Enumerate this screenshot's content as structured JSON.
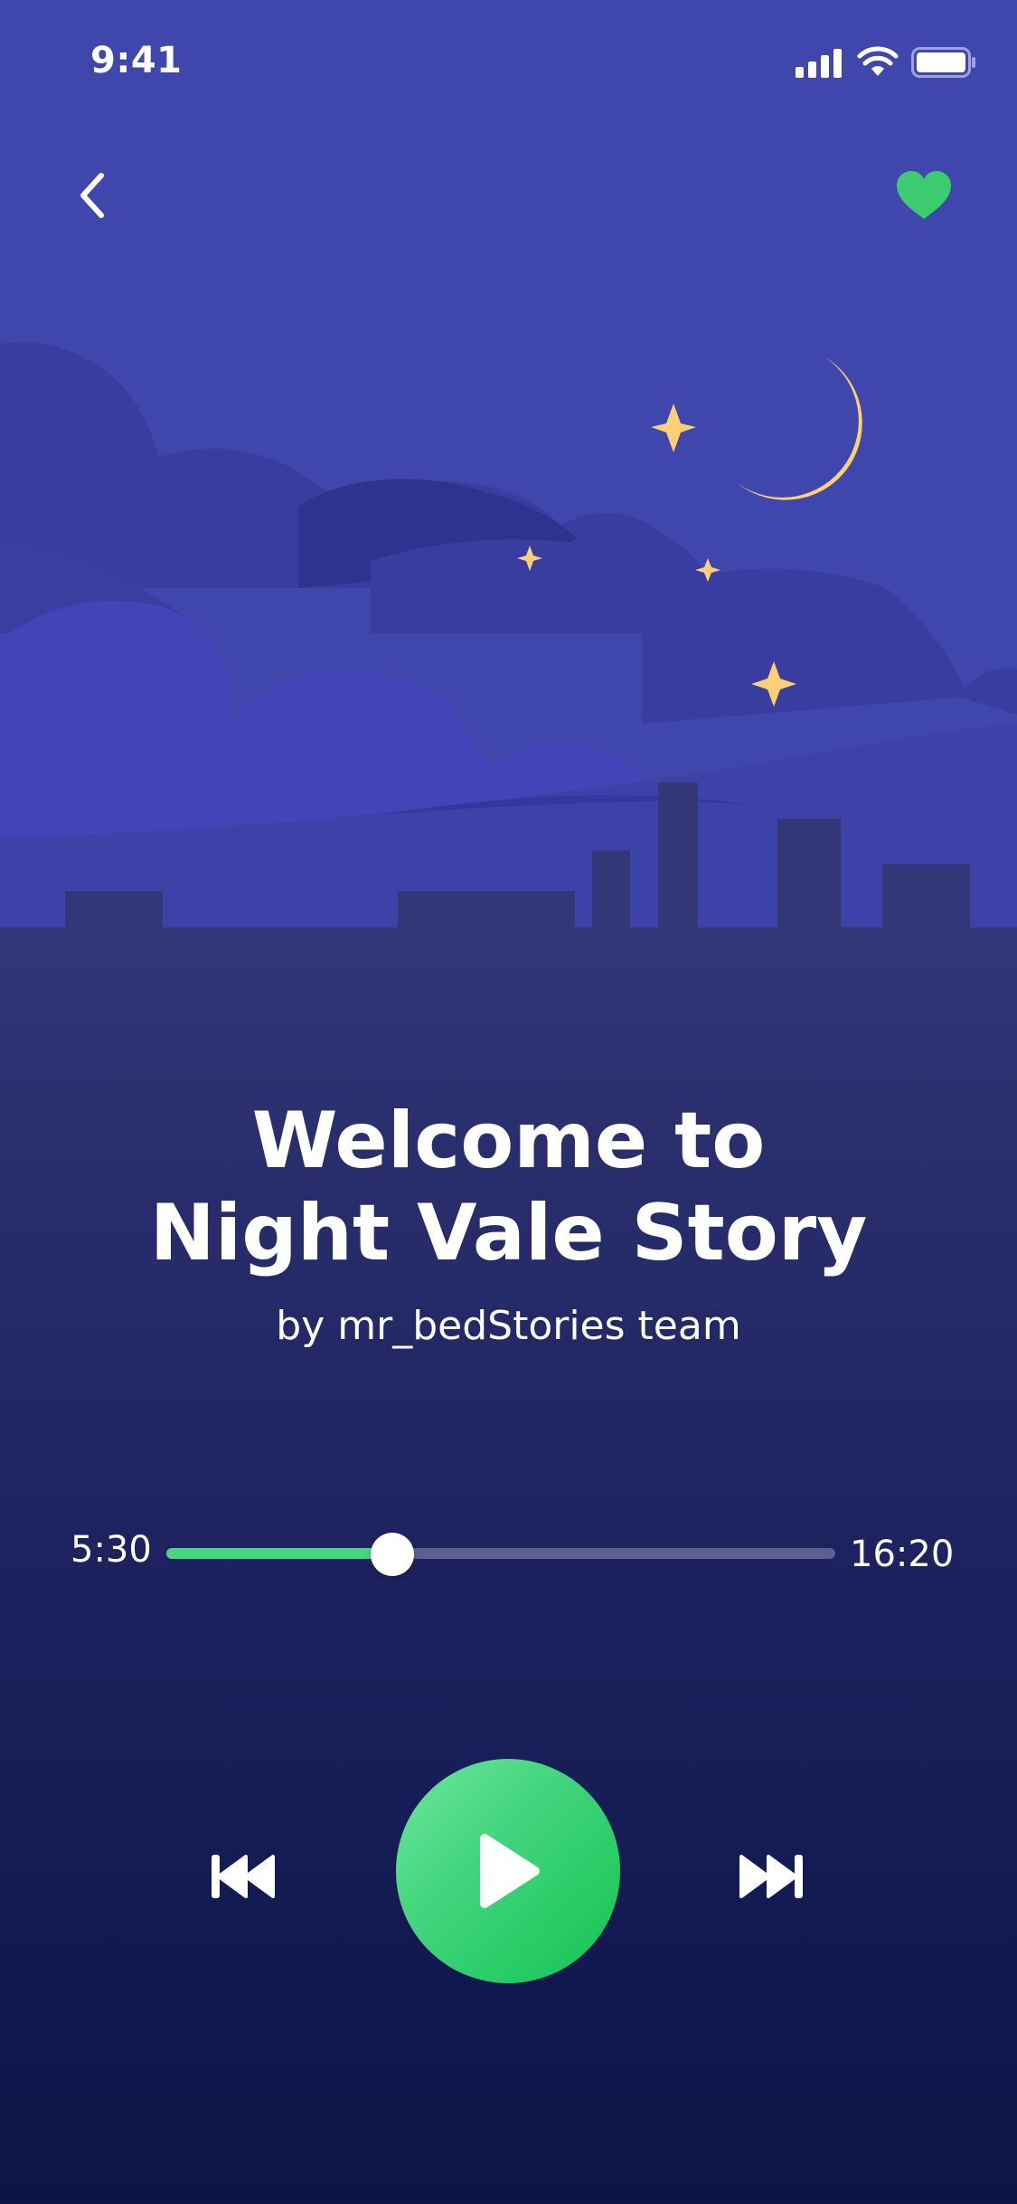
{
  "status_bar": {
    "time": "9:41"
  },
  "header": {
    "back_icon": "chevron-left-icon",
    "favorite_icon": "heart-icon"
  },
  "story": {
    "title_line1": "Welcome to",
    "title_line2": "Night Vale Story",
    "author": "by mr_bedStories team"
  },
  "player": {
    "elapsed": "5:30",
    "total": "16:20",
    "progress_fraction": 0.338,
    "rewind_icon": "skip-back-icon",
    "play_icon": "play-icon",
    "forward_icon": "skip-forward-icon"
  },
  "colors": {
    "sky": "#3f47ad",
    "accent_green": "#47d67b",
    "moon": "#ffd073",
    "heart": "#3ccb6f",
    "background_bottom": "#0d1447"
  }
}
